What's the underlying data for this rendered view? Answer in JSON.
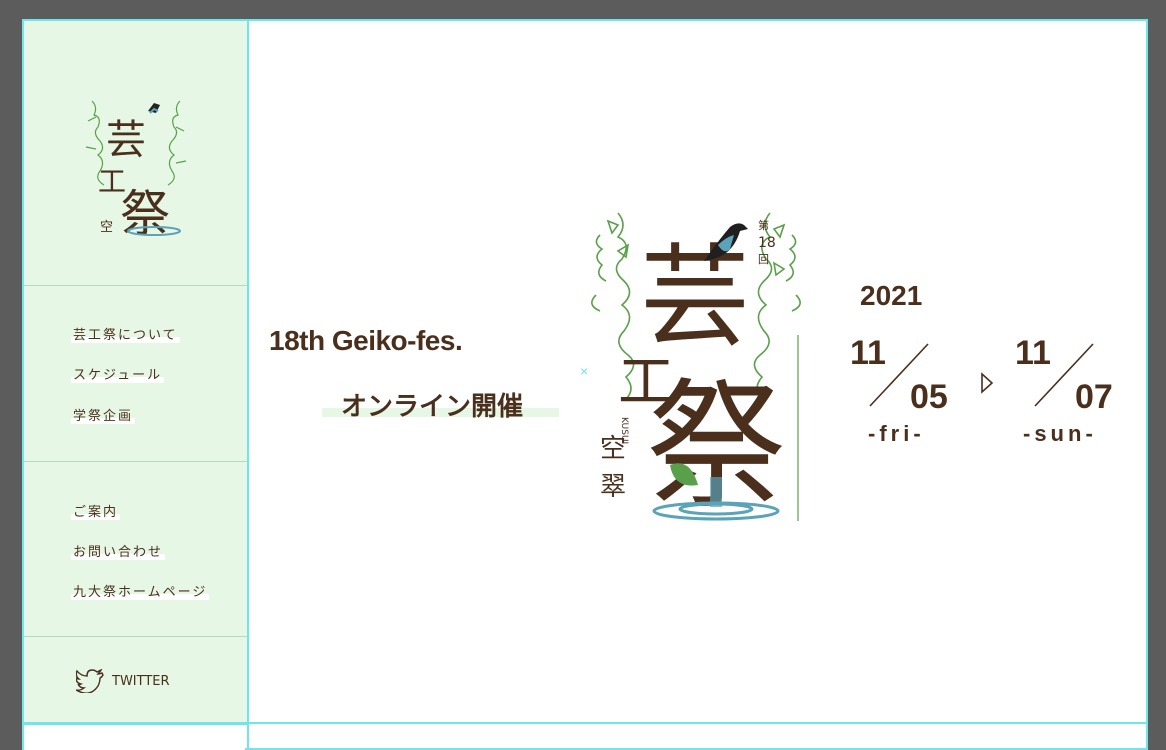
{
  "nav_group_1": [
    {
      "label": "芸工祭について"
    },
    {
      "label": "スケジュール"
    },
    {
      "label": "学祭企画"
    }
  ],
  "nav_group_2": [
    {
      "label": "ご案内"
    },
    {
      "label": "お問い合わせ"
    },
    {
      "label": "九大祭ホームページ"
    }
  ],
  "twitter": {
    "label": "TWITTER",
    "icon": "twitter-bird-icon"
  },
  "logo": {
    "main_chars": "芸工祭",
    "edition": "第18回",
    "subtitle": "空翠",
    "romaji": "KUSUI"
  },
  "hero": {
    "headline": "18th Geiko-fes.",
    "online": "オンライン開催"
  },
  "dates": {
    "year": "2021",
    "start_month": "11",
    "start_day": "05",
    "start_dow": "-fri-",
    "end_month": "11",
    "end_day": "07",
    "end_dow": "-sun-"
  },
  "colors": {
    "brown": "#4a2f1c",
    "green": "#5aa04a",
    "teal": "#5aa3b8",
    "frame": "#6fe6ee",
    "sidebar_bg": "#e6f7e6"
  }
}
